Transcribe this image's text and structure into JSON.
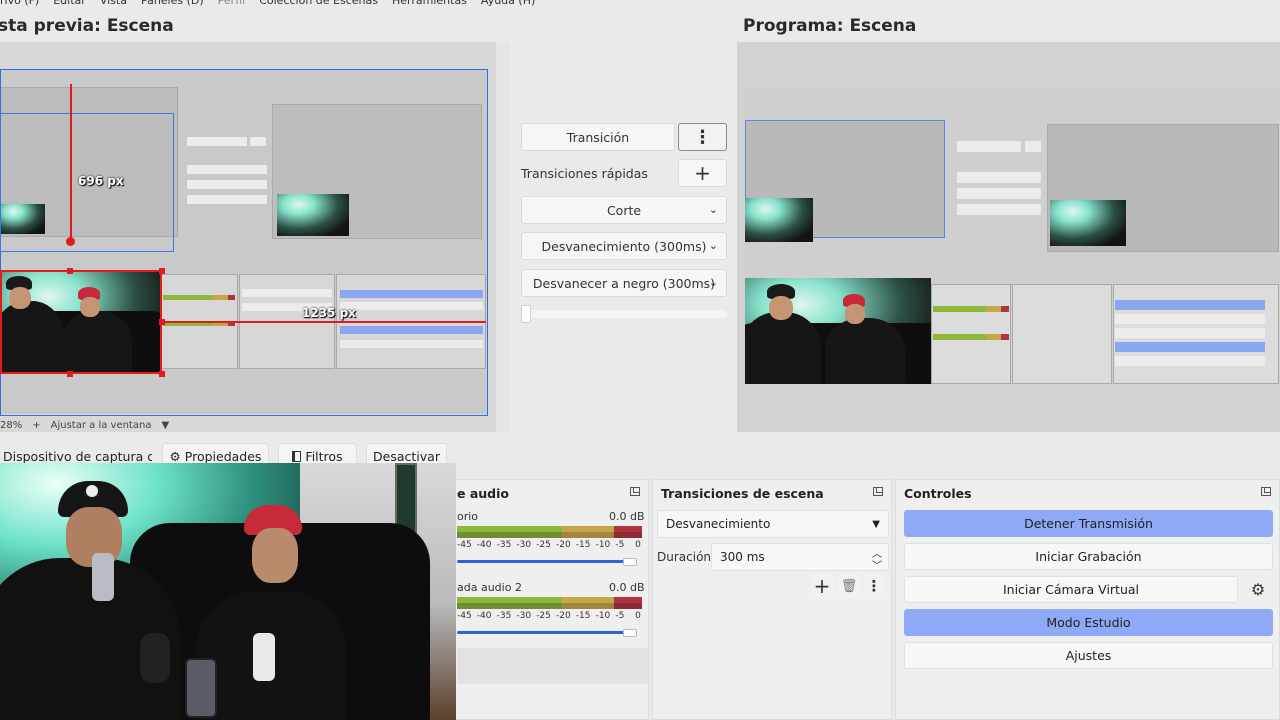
{
  "menu": {
    "items": [
      {
        "label": "rivo (F)",
        "enabled": true
      },
      {
        "label": "Editar",
        "enabled": true
      },
      {
        "label": "Vista",
        "enabled": true
      },
      {
        "label": "Paneles (D)",
        "enabled": true
      },
      {
        "label": "Perfil",
        "enabled": false
      },
      {
        "label": "Colección de Escenas",
        "enabled": true
      },
      {
        "label": "Herramientas",
        "enabled": true
      },
      {
        "label": "Ayuda (H)",
        "enabled": true
      }
    ]
  },
  "preview": {
    "title": "sta previa: Escena",
    "width_label": "696 px",
    "height_label": "1235 px",
    "zoom": "28%",
    "zoom_plus": "+",
    "fit_label": "Ajustar a la ventana"
  },
  "program": {
    "title": "Programa: Escena"
  },
  "transitions_panel": {
    "transition_button": "Transición",
    "quick_label": "Transiciones rápidas",
    "add_icon": "+",
    "options": [
      "Corte",
      "Desvanecimiento (300ms)",
      "Desvanecer a negro (300ms)"
    ],
    "slider_value": 0
  },
  "source_toolbar": {
    "source_name": "Dispositivo de captura de v",
    "properties": "Propiedades",
    "filters": "Filtros",
    "deactivate": "Desactivar"
  },
  "mixer": {
    "title": "e audio",
    "channels": [
      {
        "name": "orio",
        "db": "0.0 dB",
        "volume": 0.92
      },
      {
        "name": "ada audio 2",
        "db": "0.0 dB",
        "volume": 0.92
      }
    ],
    "ticks": [
      "-45",
      "-40",
      "-35",
      "-30",
      "-25",
      "-20",
      "-15",
      "-10",
      "-5",
      "0"
    ]
  },
  "scene_transitions": {
    "title": "Transiciones de escena",
    "selected": "Desvanecimiento",
    "duration_label": "Duración",
    "duration_value": "300 ms"
  },
  "controls": {
    "title": "Controles",
    "buttons": [
      {
        "label": "Detener Transmisión",
        "active": true
      },
      {
        "label": "Iniciar Grabación",
        "active": false
      },
      {
        "label": "Iniciar Cámara Virtual",
        "active": false
      },
      {
        "label": "Modo Estudio",
        "active": true
      },
      {
        "label": "Ajustes",
        "active": false
      }
    ]
  },
  "colors": {
    "accent_blue": "#8eaaf7",
    "guide_red": "#e21b1b",
    "selection_blue": "#2f6fe0"
  }
}
